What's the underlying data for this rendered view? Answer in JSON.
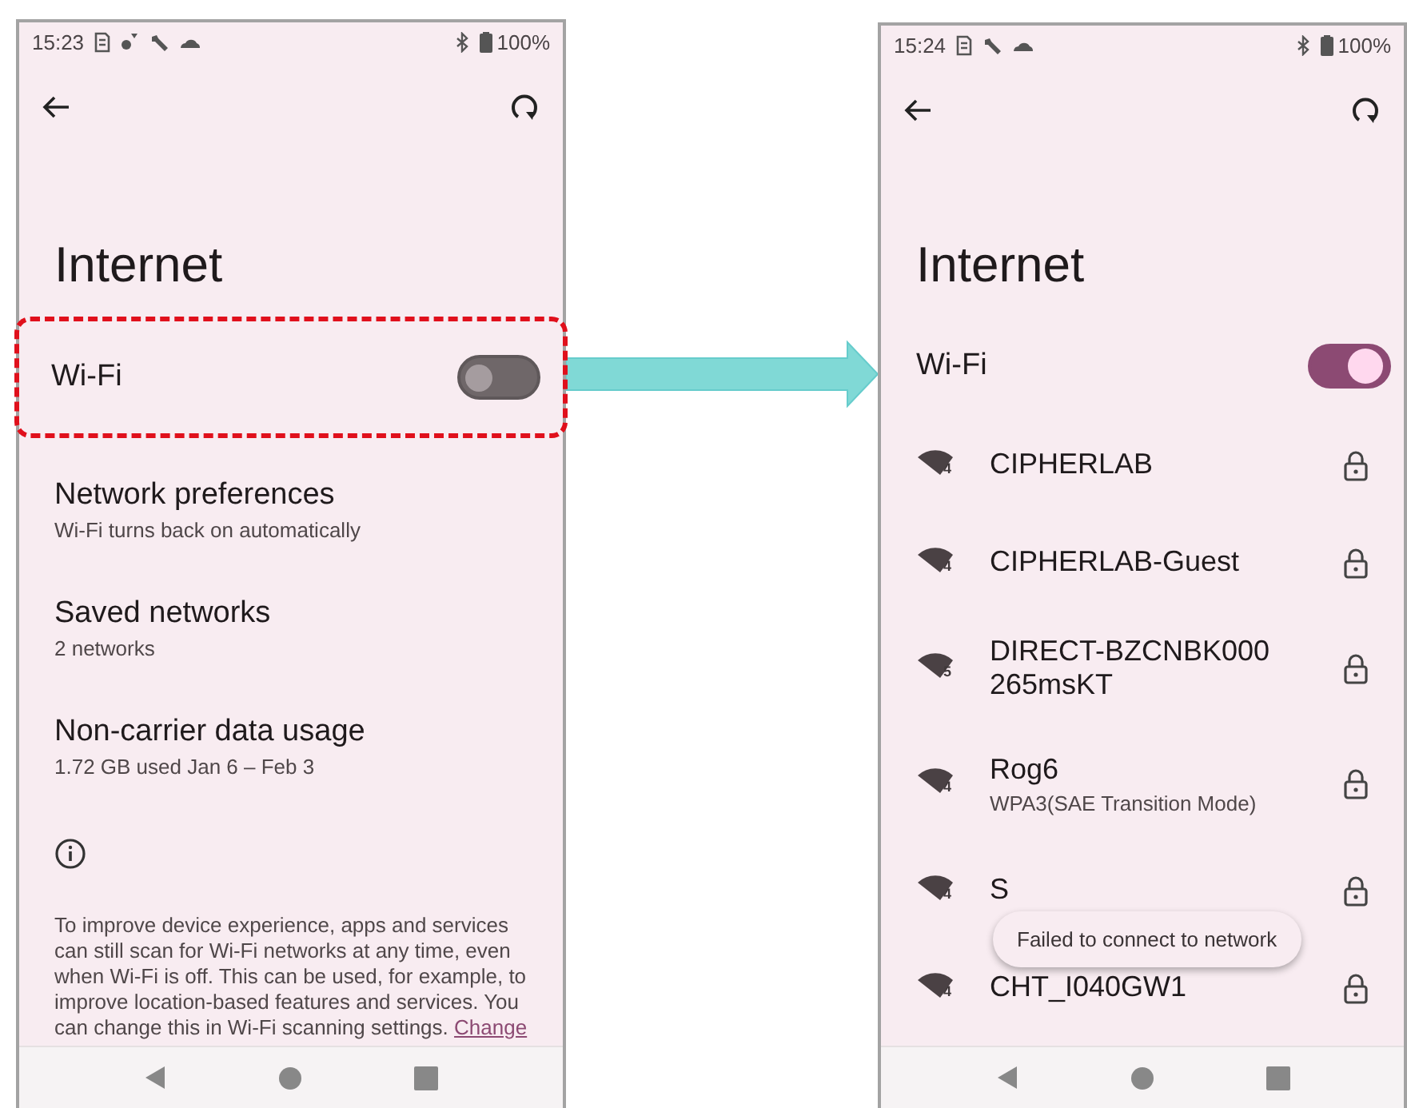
{
  "phones": [
    {
      "status_bar": {
        "time": "15:23",
        "icons": [
          {
            "kind": "sim"
          },
          {
            "kind": "dots"
          },
          {
            "kind": "wrench"
          },
          {
            "kind": "cloud"
          }
        ],
        "battery": "100%"
      },
      "title": "Internet",
      "wifi": {
        "label": "Wi-Fi",
        "on": false,
        "highlighted": true
      },
      "items": [
        {
          "title": "Network preferences",
          "subtitle": "Wi-Fi turns back on automatically"
        },
        {
          "title": "Saved networks",
          "subtitle": "2 networks"
        },
        {
          "title": "Non-carrier data usage",
          "subtitle": "1.72 GB used Jan 6 – Feb 3"
        }
      ],
      "info": {
        "text": "To improve device experience, apps and services can still scan for Wi-Fi networks at any time, even when Wi-Fi is off. This can be used, for example, to improve location-based features and services. You can change this in Wi-Fi scanning settings.",
        "link": "Change"
      }
    },
    {
      "status_bar": {
        "time": "15:24",
        "icons": [
          {
            "kind": "sim"
          },
          {
            "kind": "wrench"
          },
          {
            "kind": "cloud"
          }
        ],
        "battery": "100%"
      },
      "title": "Internet",
      "wifi": {
        "label": "Wi-Fi",
        "on": true,
        "highlighted": false
      },
      "networks": [
        {
          "name": "CIPHERLAB",
          "standard": "4"
        },
        {
          "name": "CIPHERLAB-Guest",
          "standard": "4"
        },
        {
          "name": "DIRECT-BZCNBK000 265msKT",
          "standard": "5"
        },
        {
          "name": "Rog6",
          "detail": "WPA3(SAE Transition Mode)",
          "standard": "4"
        },
        {
          "name": "S",
          "standard": "4"
        },
        {
          "name": "CHT_I040GW1",
          "standard": "4"
        }
      ],
      "toast": "Failed to connect to network"
    }
  ]
}
